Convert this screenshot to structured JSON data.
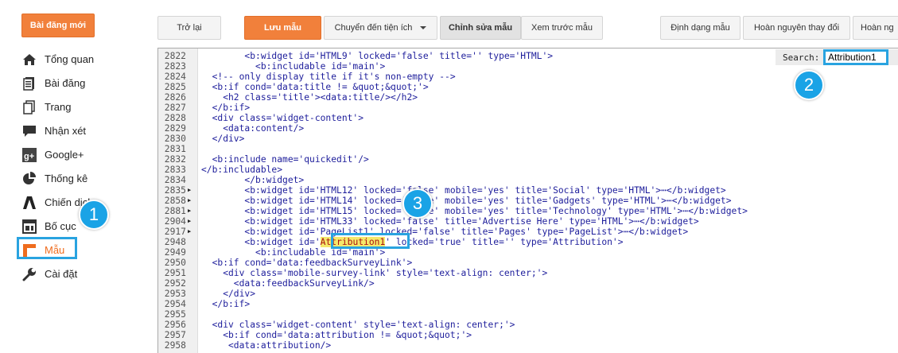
{
  "new_post_button": "Bài đăng mới",
  "sidebar": {
    "items": [
      {
        "label": "Tổng quan",
        "icon": "home-icon"
      },
      {
        "label": "Bài đăng",
        "icon": "posts-icon"
      },
      {
        "label": "Trang",
        "icon": "pages-icon"
      },
      {
        "label": "Nhận xét",
        "icon": "comment-icon"
      },
      {
        "label": "Google+",
        "icon": "google-plus-icon"
      },
      {
        "label": "Thống kê",
        "icon": "pie-chart-icon"
      },
      {
        "label": "Chiến dịch",
        "icon": "campaign-icon"
      },
      {
        "label": "Bố cục",
        "icon": "layout-icon"
      },
      {
        "label": "Mẫu",
        "icon": "template-icon"
      },
      {
        "label": "Cài đặt",
        "icon": "wrench-icon"
      }
    ]
  },
  "toolbar": {
    "back": "Trở lại",
    "save": "Lưu mẫu",
    "jump_to_widget": "Chuyển đến tiện ích",
    "edit_template": "Chỉnh sửa mẫu",
    "preview_template": "Xem trước mẫu",
    "format_template": "Định dạng mẫu",
    "revert_changes": "Hoàn nguyên thay đổi",
    "revert_more": "Hoàn ng"
  },
  "search": {
    "label": "Search:",
    "value": "Attribution1"
  },
  "code_lines": [
    {
      "n": "2822",
      "f": "",
      "t": "        <b:widget id='HTML9' locked='false' title='' type='HTML'>"
    },
    {
      "n": "2823",
      "f": "",
      "t": "          <b:includable id='main'>"
    },
    {
      "n": "2824",
      "f": "",
      "t": "  <!-- only display title if it's non-empty -->"
    },
    {
      "n": "2825",
      "f": "",
      "t": "  <b:if cond='data:title != &quot;&quot;'>"
    },
    {
      "n": "2826",
      "f": "",
      "t": "    <h2 class='title'><data:title/></h2>"
    },
    {
      "n": "2827",
      "f": "",
      "t": "  </b:if>"
    },
    {
      "n": "2828",
      "f": "",
      "t": "  <div class='widget-content'>"
    },
    {
      "n": "2829",
      "f": "",
      "t": "    <data:content/>"
    },
    {
      "n": "2830",
      "f": "",
      "t": "  </div>"
    },
    {
      "n": "2831",
      "f": "",
      "t": ""
    },
    {
      "n": "2832",
      "f": "",
      "t": "  <b:include name='quickedit'/>"
    },
    {
      "n": "2833",
      "f": "",
      "t": "</b:includable>"
    },
    {
      "n": "2834",
      "f": "",
      "t": "        </b:widget>"
    },
    {
      "n": "2835",
      "f": "▶",
      "t": "        <b:widget id='HTML12' locked='false' mobile='yes' title='Social' type='HTML'>⋯</b:widget>"
    },
    {
      "n": "2858",
      "f": "▶",
      "t": "        <b:widget id='HTML14' locked='false' mobile='yes' title='Gadgets' type='HTML'>⋯</b:widget>"
    },
    {
      "n": "2881",
      "f": "▶",
      "t": "        <b:widget id='HTML15' locked='false' mobile='yes' title='Technology' type='HTML'>⋯</b:widget>"
    },
    {
      "n": "2904",
      "f": "▶",
      "t": "        <b:widget id='HTML33' locked='false' title='Advertise Here' type='HTML'>⋯</b:widget>"
    },
    {
      "n": "2917",
      "f": "▶",
      "t": "        <b:widget id='PageList1' locked='false' title='Pages' type='PageList'>⋯</b:widget>"
    },
    {
      "n": "2948",
      "f": "",
      "pre": "        <b:widget id='",
      "hl": "Attribution1",
      "post": "' locked='true' title='' type='Attribution'>"
    },
    {
      "n": "2949",
      "f": "",
      "t": "          <b:includable id='main'>"
    },
    {
      "n": "2950",
      "f": "",
      "t": "  <b:if cond='data:feedbackSurveyLink'>"
    },
    {
      "n": "2951",
      "f": "",
      "t": "    <div class='mobile-survey-link' style='text-align: center;'>"
    },
    {
      "n": "2952",
      "f": "",
      "t": "      <data:feedbackSurveyLink/>"
    },
    {
      "n": "2953",
      "f": "",
      "t": "    </div>"
    },
    {
      "n": "2954",
      "f": "",
      "t": "  </b:if>"
    },
    {
      "n": "2955",
      "f": "",
      "t": ""
    },
    {
      "n": "2956",
      "f": "",
      "t": "  <div class='widget-content' style='text-align: center;'>"
    },
    {
      "n": "2957",
      "f": "",
      "t": "    <b:if cond='data:attribution != &quot;&quot;'>"
    },
    {
      "n": "2958",
      "f": "",
      "t": "     <data:attribution/>"
    }
  ],
  "badges": [
    "1",
    "2",
    "3"
  ],
  "colors": {
    "accent_orange": "#f1803b",
    "callout_blue": "#29a3e0",
    "highlight": "#f5e86a"
  }
}
